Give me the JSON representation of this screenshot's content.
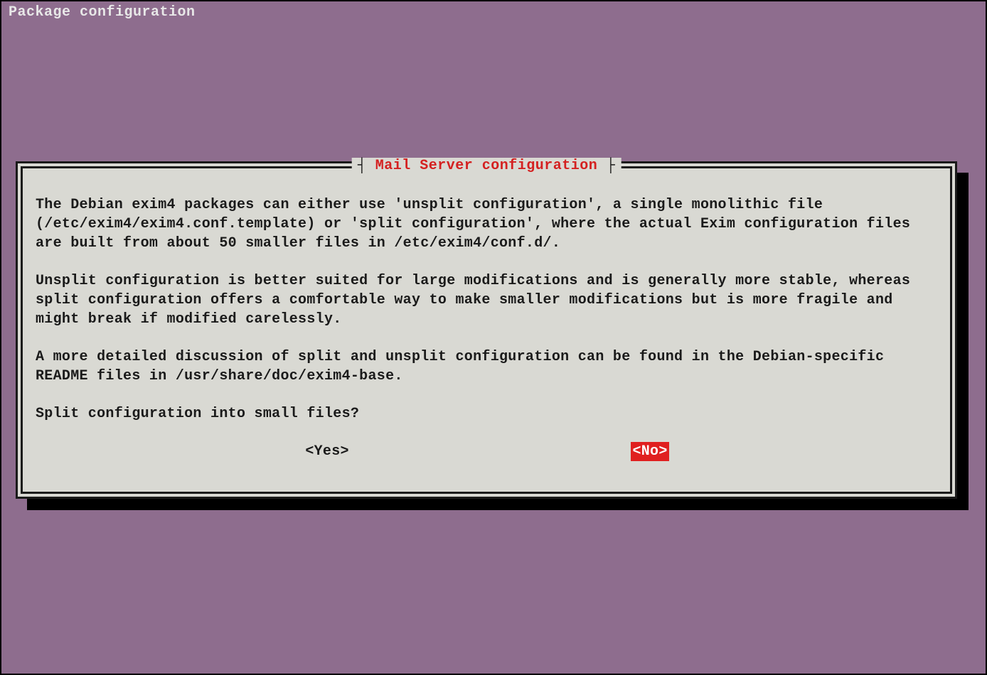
{
  "header": {
    "title": "Package configuration"
  },
  "dialog": {
    "title": "Mail Server configuration",
    "paragraphs": [
      "The Debian exim4 packages can either use 'unsplit configuration', a single monolithic file (/etc/exim4/exim4.conf.template) or 'split configuration', where the actual Exim configuration files are built from about 50 smaller files in /etc/exim4/conf.d/.",
      "Unsplit configuration is better suited for large modifications and is generally more stable, whereas split configuration offers a comfortable way to make smaller modifications but is more fragile and might break if modified carelessly.",
      "A more detailed discussion of split and unsplit configuration can be found in the Debian-specific README files in /usr/share/doc/exim4-base.",
      "Split configuration into small files?"
    ],
    "buttons": {
      "yes": "<Yes>",
      "no": "<No>"
    },
    "selected": "no"
  },
  "colors": {
    "background": "#8e6d8e",
    "dialog_bg": "#d9d9d3",
    "accent": "#d42020",
    "text": "#1a1a1a",
    "header_text": "#e8e8e8"
  }
}
